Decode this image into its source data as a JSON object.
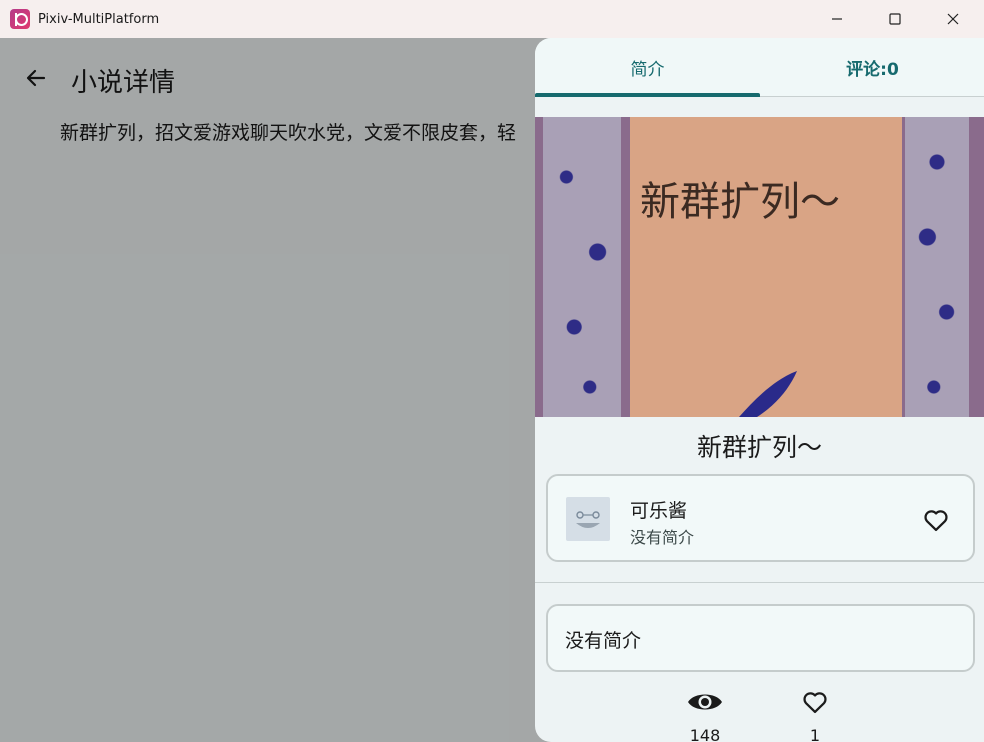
{
  "window": {
    "title": "Pixiv-MultiPlatform"
  },
  "page": {
    "title": "小说详情",
    "summary": "新群扩列，招文爱游戏聊天吹水党，文爱不限皮套，轻"
  },
  "sheet": {
    "tabs": [
      {
        "label": "简介",
        "selected": true
      },
      {
        "label": "评论:0",
        "selected": false
      }
    ],
    "cover_text": "新群扩列～",
    "novel_title": "新群扩列～",
    "author": {
      "name": "可乐酱",
      "bio": "没有简介"
    },
    "description": "没有简介",
    "stats": {
      "views": "148",
      "likes": "1"
    }
  },
  "colors": {
    "accent": "#166a6e",
    "scrim": "#000000",
    "sheet_bg": "#edf3f4"
  },
  "icons": {
    "back": "arrow-left-icon",
    "follow": "heart-outline-icon",
    "views": "eye-icon",
    "likes": "heart-outline-icon"
  }
}
